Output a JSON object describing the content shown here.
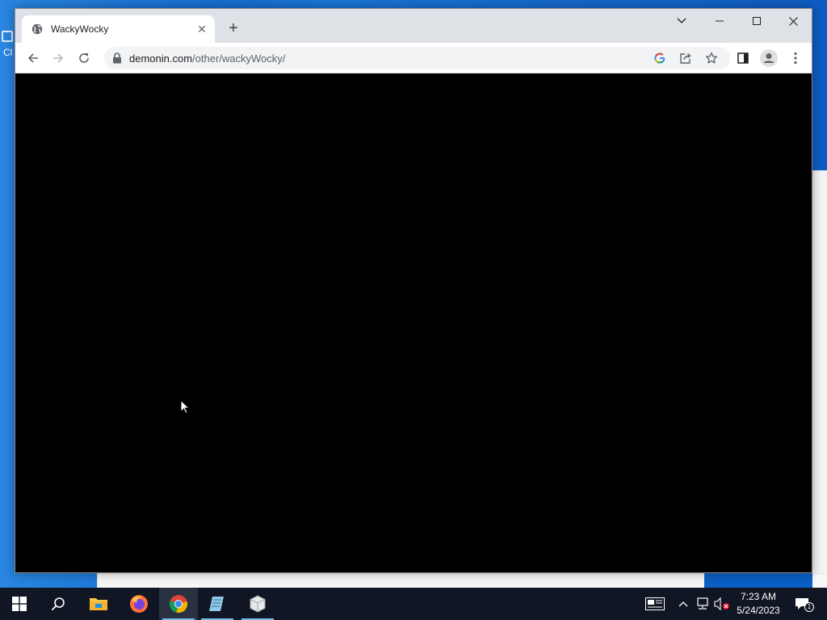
{
  "desktop": {
    "icon_stub_text": "Cl"
  },
  "browser": {
    "tab": {
      "title": "WackyWocky",
      "favicon": "globe-icon",
      "close_label": "✕"
    },
    "new_tab_label": "+",
    "window_controls": {
      "tab_search": "tab-search-chevron",
      "minimize": "—",
      "maximize": "☐",
      "close": "✕"
    },
    "nav": {
      "back": "back-arrow-icon",
      "forward": "forward-arrow-icon",
      "reload": "reload-icon"
    },
    "omnibox": {
      "host": "demonin.com",
      "path": "/other/wackyWocky/",
      "icons": [
        "google-icon",
        "share-icon",
        "bookmark-star-icon"
      ]
    },
    "toolbar_icons": [
      "side-panel-icon",
      "profile-icon",
      "menu-kebab-icon"
    ],
    "content_background": "#000000"
  },
  "taskbar": {
    "items": [
      "start-icon",
      "search-icon",
      "file-explorer-icon",
      "firefox-icon",
      "chrome-icon",
      "notepad-icon",
      "package-icon"
    ],
    "active_item": "chrome-icon",
    "clock": {
      "time": "7:23 AM",
      "date": "5/24/2023"
    },
    "notification_count": "1"
  },
  "colors": {
    "desktop_blue": "#0b5fc4",
    "titlebar": "#dee1e6",
    "taskbar": "#101623",
    "accent_underline": "#76b9ed"
  }
}
